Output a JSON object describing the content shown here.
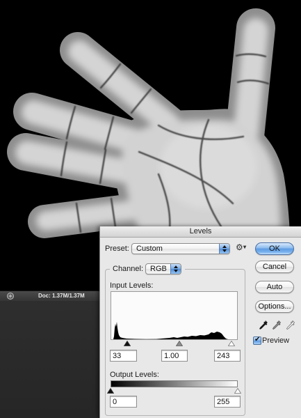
{
  "status_bar": {
    "doc_info": "Doc: 1.37M/1.37M"
  },
  "dialog": {
    "title": "Levels",
    "preset": {
      "label": "Preset:",
      "value": "Custom"
    },
    "channel": {
      "label": "Channel:",
      "value": "RGB"
    },
    "input_levels": {
      "label": "Input Levels:",
      "black": "33",
      "gamma": "1.00",
      "white": "243"
    },
    "output_levels": {
      "label": "Output Levels:",
      "black": "0",
      "white": "255"
    },
    "buttons": {
      "ok": "OK",
      "cancel": "Cancel",
      "auto": "Auto",
      "options": "Options..."
    },
    "preview": {
      "label": "Preview",
      "checked": true
    }
  },
  "icons": {
    "status_icon": "document-info-icon",
    "preset_menu_icon": "gear-icon",
    "select_arrows_icon": "stepper-arrows-icon",
    "eyedroppers": [
      "black-point-eyedropper-icon",
      "gray-point-eyedropper-icon",
      "white-point-eyedropper-icon"
    ]
  },
  "colors": {
    "canvas_background": "#000000",
    "default_button": "#5e9be2",
    "dialog_background": "#e8e8e8"
  }
}
